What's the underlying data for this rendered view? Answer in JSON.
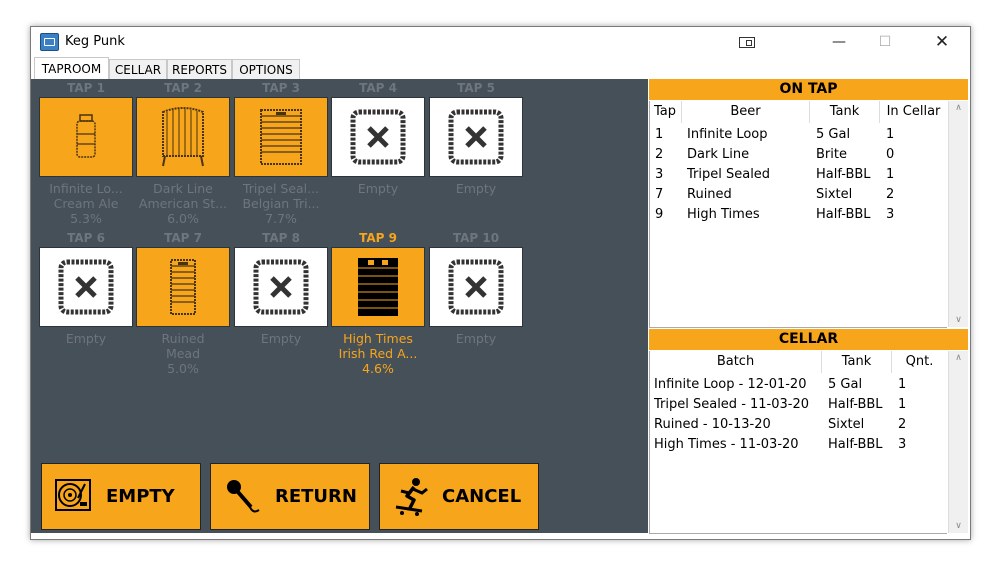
{
  "window": {
    "title": "Keg Punk"
  },
  "tabs": [
    {
      "label": "TAPROOM",
      "active": true
    },
    {
      "label": "CELLAR",
      "active": false
    },
    {
      "label": "REPORTS",
      "active": false
    },
    {
      "label": "OPTIONS",
      "active": false
    }
  ],
  "taps": [
    {
      "label": "TAP 1",
      "state": "full",
      "keg": "5 Gal",
      "lines": [
        "Infinite Lo...",
        "Cream Ale",
        "5.3%"
      ],
      "selected": false
    },
    {
      "label": "TAP 2",
      "state": "full",
      "keg": "Brite",
      "lines": [
        "Dark Line",
        "American St...",
        "6.0%"
      ],
      "selected": false
    },
    {
      "label": "TAP 3",
      "state": "full",
      "keg": "Half-BBL",
      "lines": [
        "Tripel Seal...",
        "Belgian Tri...",
        "7.7%"
      ],
      "selected": false
    },
    {
      "label": "TAP 4",
      "state": "empty",
      "keg": "",
      "lines": [
        "Empty"
      ],
      "selected": false
    },
    {
      "label": "TAP 5",
      "state": "empty",
      "keg": "",
      "lines": [
        "Empty"
      ],
      "selected": false
    },
    {
      "label": "TAP 6",
      "state": "empty",
      "keg": "",
      "lines": [
        "Empty"
      ],
      "selected": false
    },
    {
      "label": "TAP 7",
      "state": "full",
      "keg": "Sixtel",
      "lines": [
        "Ruined",
        "Mead",
        "5.0%"
      ],
      "selected": false
    },
    {
      "label": "TAP 8",
      "state": "empty",
      "keg": "",
      "lines": [
        "Empty"
      ],
      "selected": false
    },
    {
      "label": "TAP 9",
      "state": "full",
      "keg": "Half-BBL",
      "lines": [
        "High Times",
        "Irish Red A...",
        "4.6%"
      ],
      "selected": true
    },
    {
      "label": "TAP 10",
      "state": "empty",
      "keg": "",
      "lines": [
        "Empty"
      ],
      "selected": false
    }
  ],
  "actions": {
    "empty": {
      "label": "EMPTY",
      "icon": "turntable-icon"
    },
    "return": {
      "label": "RETURN",
      "icon": "microphone-icon"
    },
    "cancel": {
      "label": "CANCEL",
      "icon": "skateboarder-icon"
    }
  },
  "on_tap": {
    "title": "ON TAP",
    "columns": [
      "Tap",
      "Beer",
      "Tank",
      "In Cellar"
    ],
    "rows": [
      [
        "1",
        "Infinite Loop",
        "5 Gal",
        "1"
      ],
      [
        "2",
        "Dark Line",
        "Brite",
        "0"
      ],
      [
        "3",
        "Tripel Sealed",
        "Half-BBL",
        "1"
      ],
      [
        "7",
        "Ruined",
        "Sixtel",
        "2"
      ],
      [
        "9",
        "High Times",
        "Half-BBL",
        "3"
      ]
    ]
  },
  "cellar": {
    "title": "CELLAR",
    "columns": [
      "Batch",
      "Tank",
      "Qnt."
    ],
    "rows": [
      [
        "Infinite Loop - 12-01-20",
        "5 Gal",
        "1"
      ],
      [
        "Tripel Sealed - 11-03-20",
        "Half-BBL",
        "1"
      ],
      [
        "Ruined - 10-13-20",
        "Sixtel",
        "2"
      ],
      [
        "High Times - 11-03-20",
        "Half-BBL",
        "3"
      ]
    ]
  },
  "colors": {
    "accent": "#f7a51b",
    "panel": "#465059",
    "dim_text": "#6d757d"
  }
}
